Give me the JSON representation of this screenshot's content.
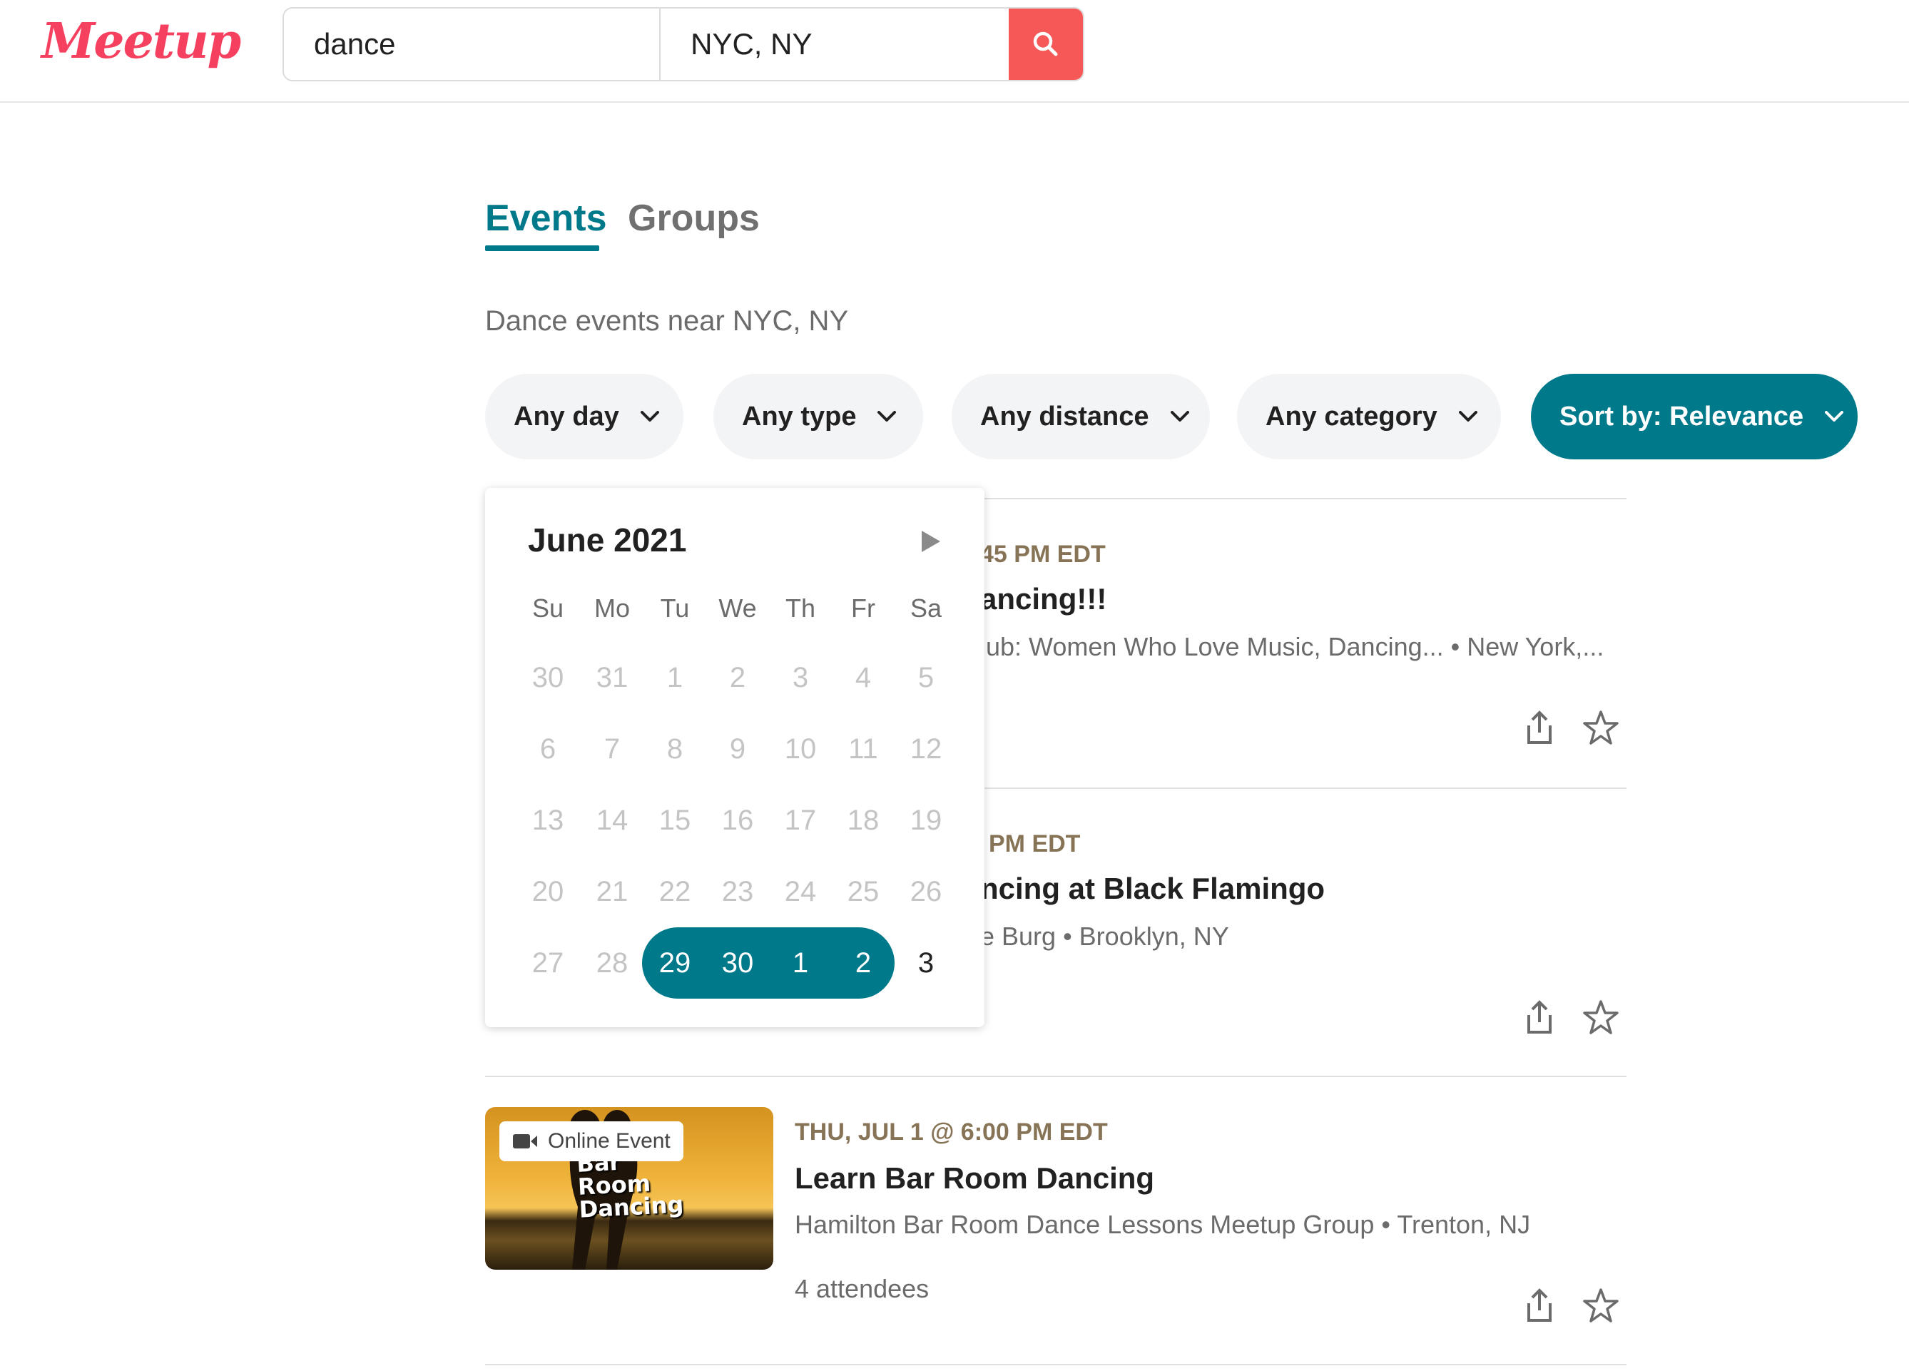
{
  "header": {
    "logo_text": "Meetup",
    "search_value": "dance",
    "location_value": "NYC, NY",
    "search_button_icon": "search-icon",
    "brand_color": "#f64060",
    "search_button_color": "#f65858"
  },
  "tabs": [
    {
      "label": "Events",
      "active": true
    },
    {
      "label": "Groups",
      "active": false
    }
  ],
  "subtitle": "Dance events near NYC, NY",
  "filters": {
    "day": "Any day",
    "type": "Any type",
    "distance": "Any distance",
    "category": "Any category",
    "sort": "Sort by: Relevance"
  },
  "accent_color": "#00798a",
  "calendar": {
    "month": "June 2021",
    "weekdays": [
      "Su",
      "Mo",
      "Tu",
      "We",
      "Th",
      "Fr",
      "Sa"
    ],
    "weeks": [
      [
        "30",
        "31",
        "1",
        "2",
        "3",
        "4",
        "5"
      ],
      [
        "6",
        "7",
        "8",
        "9",
        "10",
        "11",
        "12"
      ],
      [
        "13",
        "14",
        "15",
        "16",
        "17",
        "18",
        "19"
      ],
      [
        "20",
        "21",
        "22",
        "23",
        "24",
        "25",
        "26"
      ],
      [
        "27",
        "28",
        "29",
        "30",
        "1",
        "2",
        "3"
      ]
    ],
    "selected_range": [
      "29",
      "30",
      "1",
      "2"
    ],
    "next_month_icon": "triangle-right-icon"
  },
  "events": [
    {
      "date": "45 PM EDT",
      "title": "ancing!!!",
      "group": "lub: Women Who Love Music, Dancing... • New York,..."
    },
    {
      "date": "PM EDT",
      "title": "ncing at Black Flamingo",
      "group": "e Burg • Brooklyn, NY"
    },
    {
      "date": "THU, JUL 1 @ 6:00 PM EDT",
      "title": "Learn Bar Room Dancing",
      "group": "Hamilton Bar Room Dance Lessons Meetup Group • Trenton, NJ",
      "attendees": "4 attendees",
      "badge": "Online Event",
      "thumbnail_text": [
        "Bar",
        "Room",
        "Dancing"
      ]
    }
  ],
  "icons": {
    "share": "share-icon",
    "save": "star-icon"
  }
}
